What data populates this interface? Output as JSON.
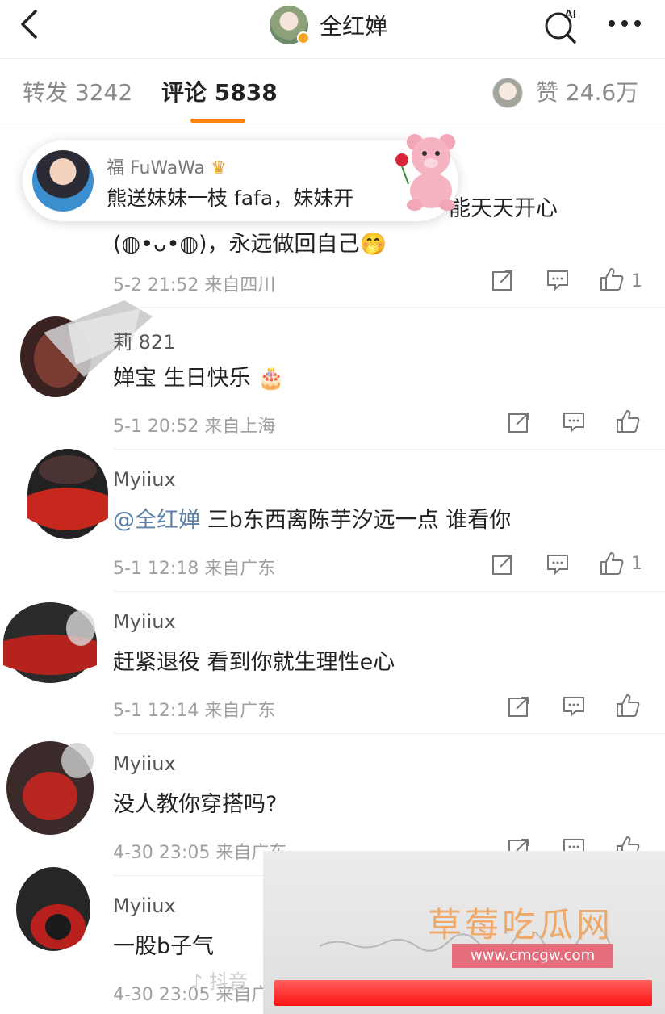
{
  "topbar": {
    "title": "全红婵",
    "ai_label": "AI"
  },
  "tabs": {
    "repost": "转发 3242",
    "comment": "评论 5838",
    "like": "赞 24.6万"
  },
  "gift": {
    "name": "福 FuWaWa",
    "text": "熊送妹妹一枝 fafa，妹妹开"
  },
  "comments": [
    {
      "name": "",
      "text": "能天天开心",
      "text2": "(◍•ᴗ•◍)，永远做回自己",
      "emoji": "🤭",
      "time": "5-2 21:52",
      "location": "来自四川",
      "likes": "1"
    },
    {
      "name": "莉 821",
      "text": "婵宝 生日快乐",
      "emoji": "🎂",
      "time": "5-1 20:52",
      "location": "来自上海",
      "likes": ""
    },
    {
      "name": "Myiiux",
      "mention": "@全红婵",
      "text": " 三b东西离陈芋汐远一点  谁看你",
      "time": "5-1 12:18",
      "location": "来自广东",
      "likes": "1"
    },
    {
      "name": "Myiiux",
      "text": "赶紧退役  看到你就生理性e心",
      "time": "5-1 12:14",
      "location": "来自广东",
      "likes": ""
    },
    {
      "name": "Myiiux",
      "text": "没人教你穿搭吗?",
      "time": "4-30 23:05",
      "location": "来自广东",
      "likes": ""
    },
    {
      "name": "Myiiux",
      "text": "一股b子气",
      "time": "4-30 23:05",
      "location": "来自广东",
      "likes": ""
    }
  ],
  "watermark": {
    "logo": "草莓吃瓜网",
    "url": "www.cmcgw.com",
    "source": "抖音"
  },
  "icons": [
    "back-arrow-icon",
    "ai-search-icon",
    "more-dots-icon",
    "share-icon",
    "reply-icon",
    "thumbs-up-icon"
  ],
  "colors": {
    "accent": "#ff8200",
    "mention": "#5b7fa8",
    "meta": "#a0a0a0"
  }
}
